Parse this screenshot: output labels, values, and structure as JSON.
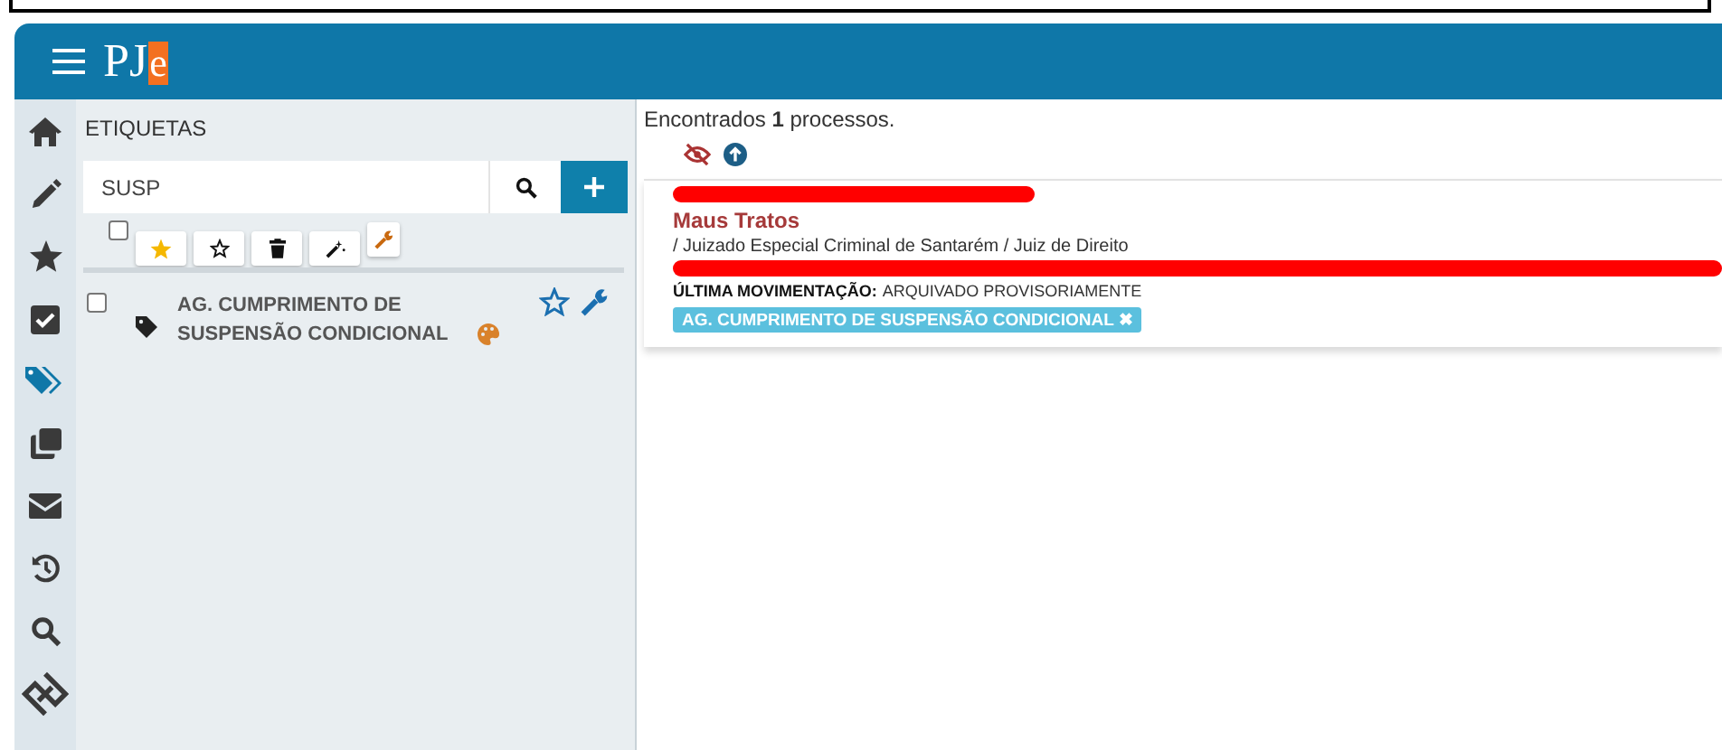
{
  "header": {
    "logo_text": "PJ",
    "logo_accent": "e"
  },
  "sidebar": {
    "items": [
      {
        "selected": false
      },
      {
        "selected": false
      },
      {
        "selected": false
      },
      {
        "selected": false
      },
      {
        "selected": true
      },
      {
        "selected": false
      },
      {
        "selected": false
      },
      {
        "selected": false
      },
      {
        "selected": false
      },
      {
        "selected": false
      }
    ]
  },
  "tags_panel": {
    "title": "ETIQUETAS",
    "search": {
      "value": "SUSP"
    },
    "select_all": {
      "checked": false
    },
    "tags": [
      {
        "label": "AG. CUMPRIMENTO DE SUSPENSÃO CONDICIONAL",
        "checked": false,
        "favorite": false
      }
    ]
  },
  "results": {
    "summary": "Encontrados **1** processos.",
    "processes": [
      {
        "subject": "Maus Tratos",
        "court": "/ Juizado Especial Criminal de Santarém / Juiz de Direito",
        "last_move_label": "ÚLTIMA MOVIMENTAÇÃO:",
        "last_move": "ARQUIVADO PROVISORIAMENTE",
        "tags": [
          "AG. CUMPRIMENTO DE SUSPENSÃO CONDICIONAL ✖"
        ]
      }
    ]
  }
}
